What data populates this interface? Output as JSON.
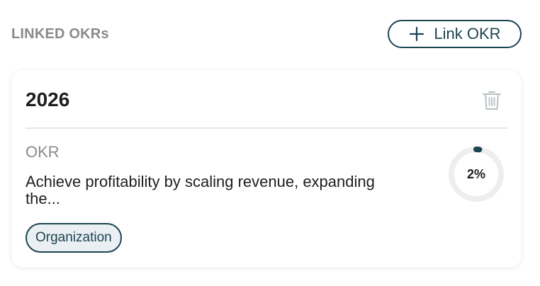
{
  "section": {
    "title": "LINKED OKRs",
    "link_button_label": "Link OKR"
  },
  "okr_card": {
    "year": "2026",
    "type_label": "OKR",
    "description": "Achieve profitability by scaling revenue, expanding the...",
    "tag": "Organization",
    "progress_text": "2%",
    "progress_fraction": 0.02
  },
  "icons": {
    "add": "plus-icon",
    "delete": "trash-icon"
  },
  "colors": {
    "accent": "#1d4451",
    "muted_text": "#8a8a8a",
    "tag_background": "#e9eff2",
    "progress_track": "#eeeeee"
  }
}
